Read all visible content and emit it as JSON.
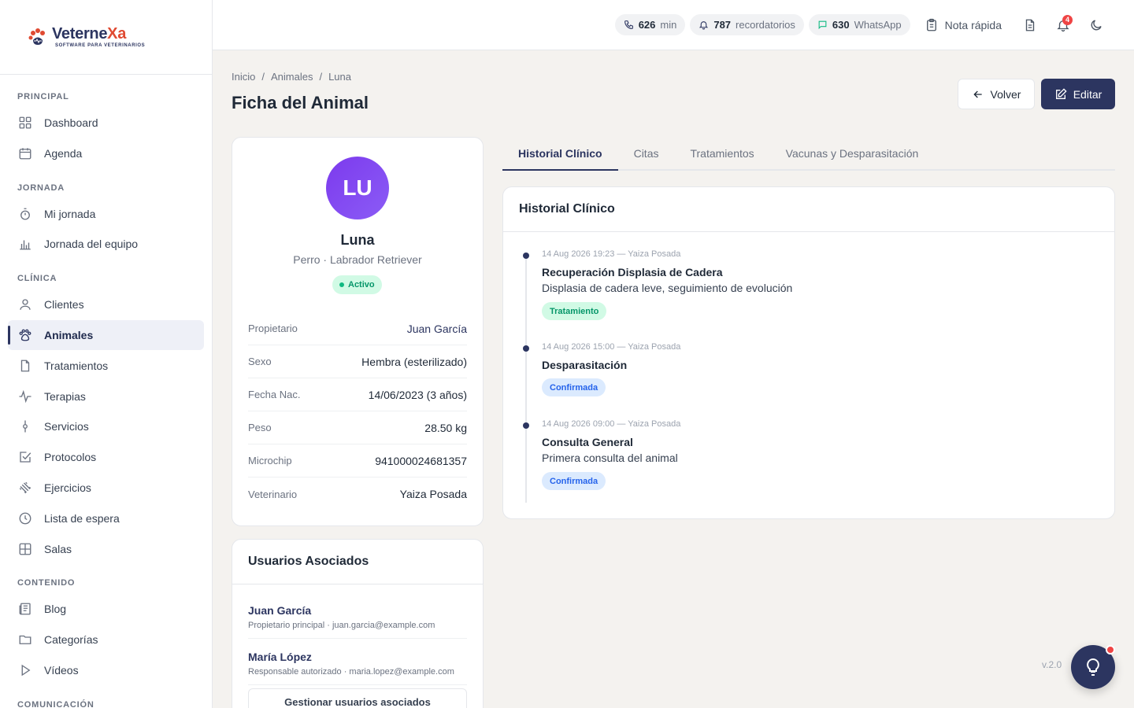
{
  "brand": {
    "name_main": "Veterne",
    "name_accent": "Xa",
    "tagline": "SOFTWARE PARA VETERINARIOS"
  },
  "sidebar": {
    "sections": [
      {
        "label": "PRINCIPAL"
      },
      {
        "label": "JORNADA"
      },
      {
        "label": "CLÍNICA"
      },
      {
        "label": "CONTENIDO"
      },
      {
        "label": "COMUNICACIÓN"
      }
    ],
    "items": [
      {
        "label": "Dashboard",
        "icon": "grid-icon"
      },
      {
        "label": "Agenda",
        "icon": "calendar-icon"
      },
      {
        "label": "Mi jornada",
        "icon": "stopwatch-icon"
      },
      {
        "label": "Jornada del equipo",
        "icon": "bar-chart-icon"
      },
      {
        "label": "Clientes",
        "icon": "user-icon"
      },
      {
        "label": "Animales",
        "icon": "paw-icon"
      },
      {
        "label": "Tratamientos",
        "icon": "file-icon"
      },
      {
        "label": "Terapias",
        "icon": "activity-icon"
      },
      {
        "label": "Servicios",
        "icon": "syringe-icon"
      },
      {
        "label": "Protocolos",
        "icon": "checkbox-icon"
      },
      {
        "label": "Ejercicios",
        "icon": "dumbbell-icon"
      },
      {
        "label": "Lista de espera",
        "icon": "clock-icon"
      },
      {
        "label": "Salas",
        "icon": "rooms-icon"
      },
      {
        "label": "Blog",
        "icon": "newspaper-icon"
      },
      {
        "label": "Categorías",
        "icon": "folder-icon"
      },
      {
        "label": "Vídeos",
        "icon": "play-icon"
      }
    ]
  },
  "topbar": {
    "calls": {
      "value": "626",
      "unit": "min"
    },
    "reminders": {
      "value": "787",
      "unit": "recordatorios"
    },
    "whatsapp": {
      "value": "630",
      "unit": "WhatsApp"
    },
    "quick_note": "Nota rápida",
    "notifications_count": "4"
  },
  "breadcrumb": [
    "Inicio",
    "/",
    "Animales",
    "/",
    "Luna"
  ],
  "page": {
    "title": "Ficha del Animal",
    "back_label": "Volver",
    "edit_label": "Editar"
  },
  "animal": {
    "initials": "LU",
    "name": "Luna",
    "species_breed": "Perro · Labrador Retriever",
    "status": "Activo",
    "details": [
      {
        "label": "Propietario",
        "value": "Juan García"
      },
      {
        "label": "Sexo",
        "value": "Hembra (esterilizado)"
      },
      {
        "label": "Fecha Nac.",
        "value": "14/06/2023 (3 años)"
      },
      {
        "label": "Peso",
        "value": "28.50 kg"
      },
      {
        "label": "Microchip",
        "value": "941000024681357"
      },
      {
        "label": "Veterinario",
        "value": "Yaiza Posada"
      }
    ]
  },
  "associated_users": {
    "title": "Usuarios Asociados",
    "users": [
      {
        "name": "Juan García",
        "meta": "Propietario principal · juan.garcia@example.com"
      },
      {
        "name": "María López",
        "meta": "Responsable autorizado · maria.lopez@example.com"
      }
    ],
    "manage_label": "Gestionar usuarios asociados"
  },
  "tabs": [
    "Historial Clínico",
    "Citas",
    "Tratamientos",
    "Vacunas y Desparasitación"
  ],
  "history": {
    "title": "Historial Clínico",
    "entries": [
      {
        "date": "14 Aug 2026 19:23 — Yaiza Posada",
        "title": "Recuperación Displasia de Cadera",
        "desc": "Displasia de cadera leve, seguimiento de evolución",
        "badge": "Tratamiento",
        "badge_color": "#059669"
      },
      {
        "date": "14 Aug 2026 15:00 — Yaiza Posada",
        "title": "Desparasitación",
        "desc": "",
        "badge": "Confirmada",
        "badge_color": "#2563eb"
      },
      {
        "date": "14 Aug 2026 09:00 — Yaiza Posada",
        "title": "Consulta General",
        "desc": "Primera consulta del animal",
        "badge": "Confirmada",
        "badge_color": "#2563eb"
      }
    ]
  },
  "version": "v.2.0",
  "colors": {
    "primary": "#2c3560",
    "accent": "#e04a32",
    "avatar": "#7c3aed",
    "success": "#10b981",
    "danger": "#ef4444"
  }
}
